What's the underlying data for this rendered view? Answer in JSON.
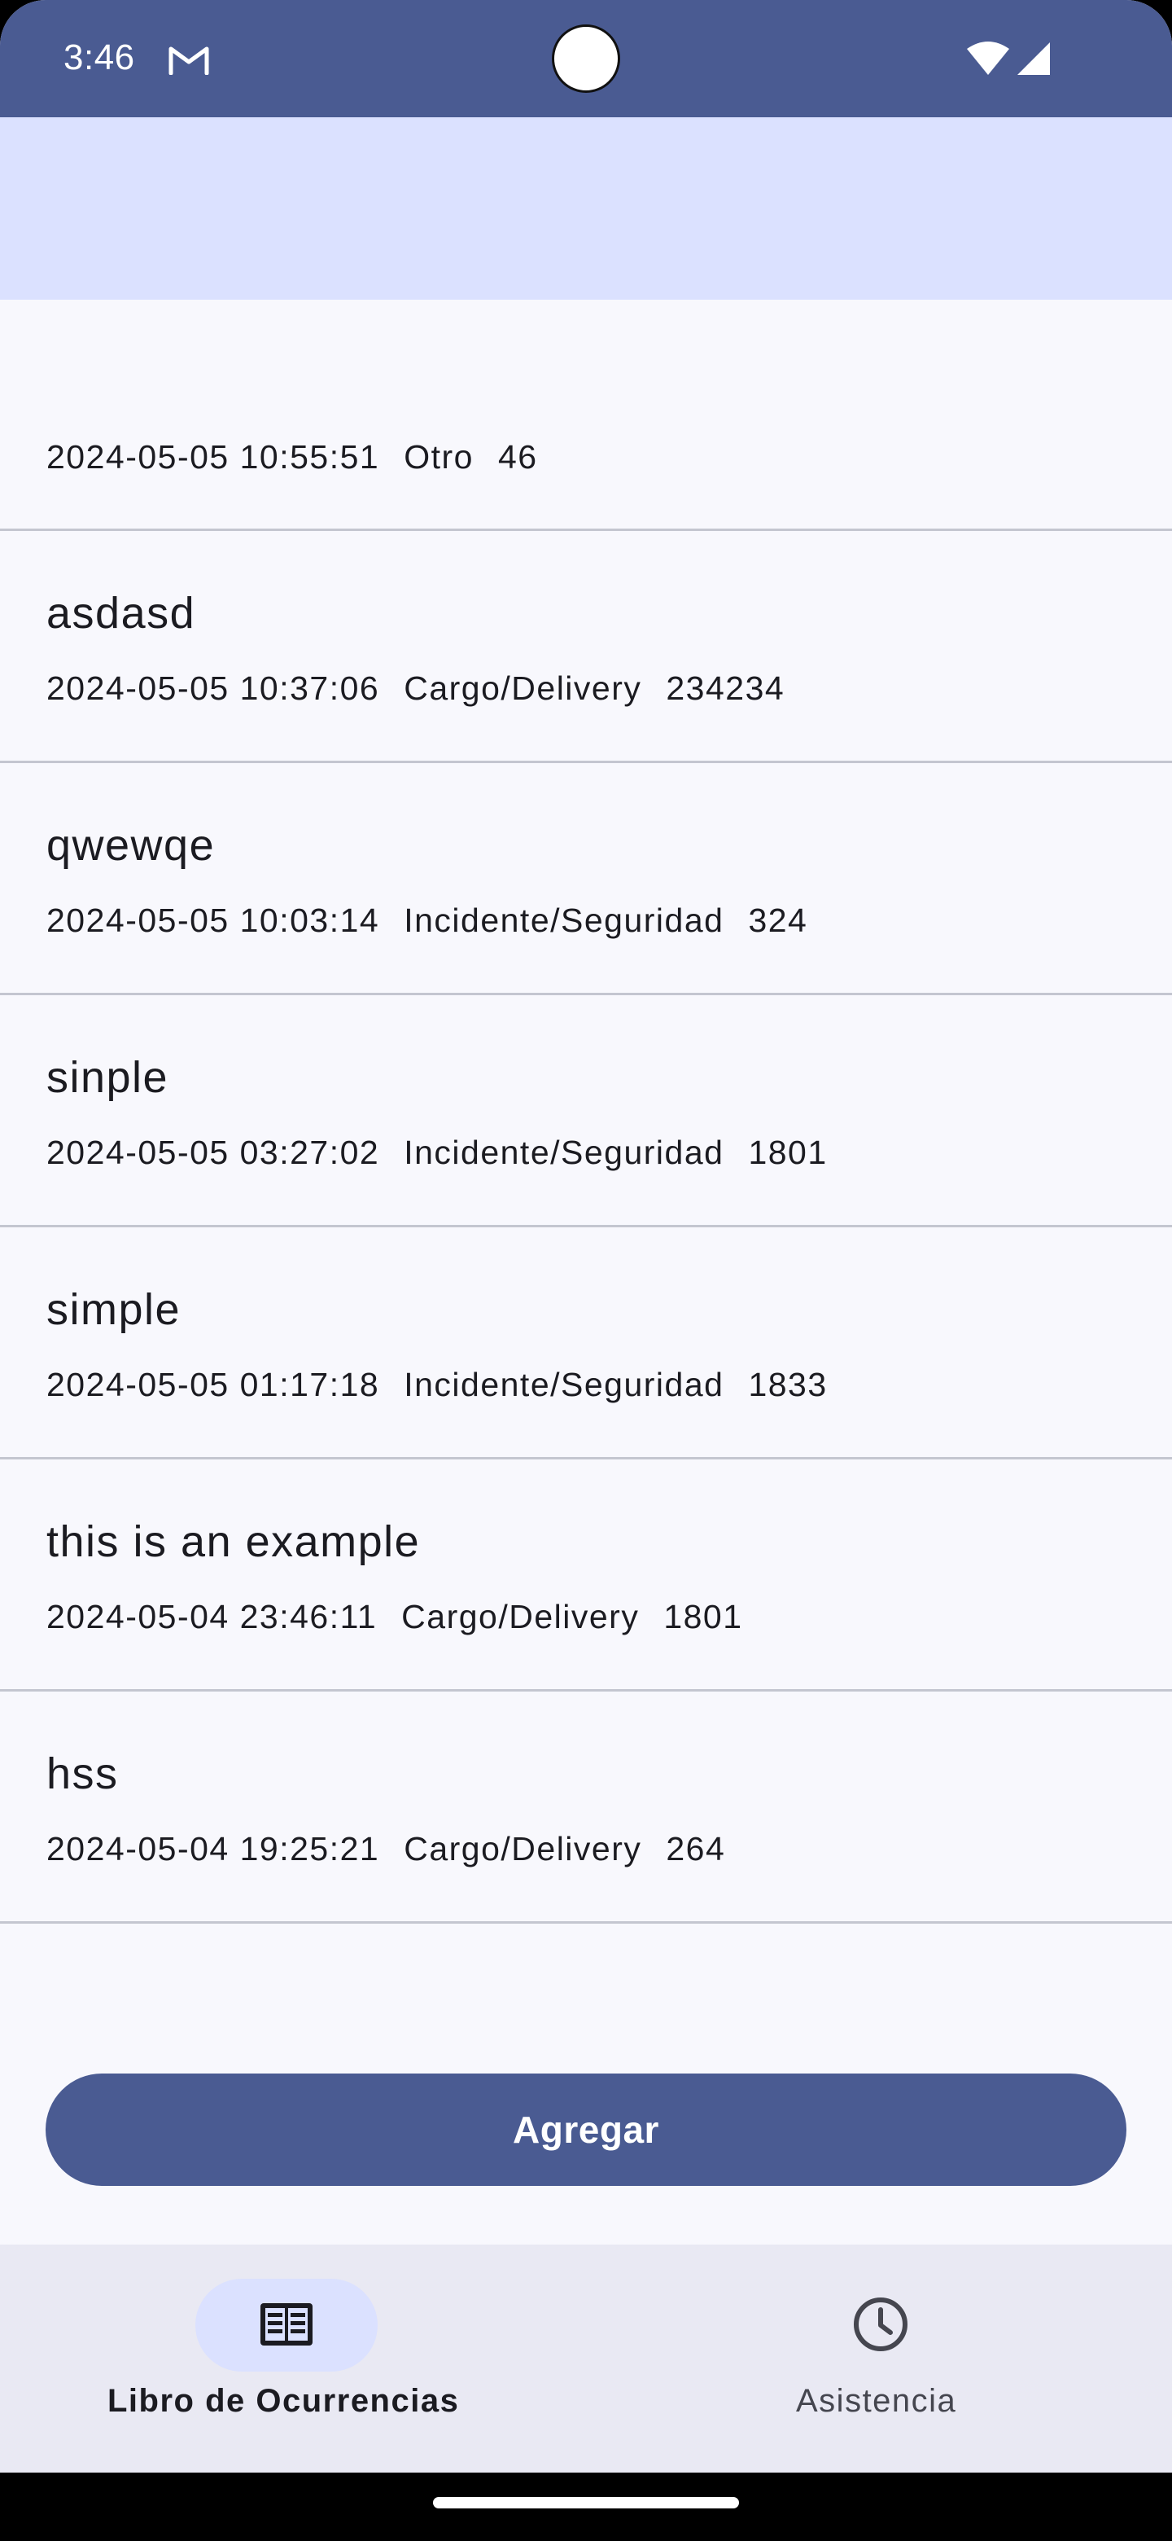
{
  "status_bar": {
    "time": "3:46",
    "icons": [
      "gmail-icon",
      "wifi-icon",
      "signal-icon"
    ]
  },
  "entries": [
    {
      "title": "",
      "datetime": "2024-05-05 10:55:51",
      "category": "Otro",
      "number": "46"
    },
    {
      "title": "asdasd",
      "datetime": "2024-05-05 10:37:06",
      "category": "Cargo/Delivery",
      "number": "234234"
    },
    {
      "title": "qwewqe",
      "datetime": "2024-05-05 10:03:14",
      "category": "Incidente/Seguridad",
      "number": "324"
    },
    {
      "title": "sinple",
      "datetime": "2024-05-05 03:27:02",
      "category": "Incidente/Seguridad",
      "number": "1801"
    },
    {
      "title": "simple",
      "datetime": "2024-05-05 01:17:18",
      "category": "Incidente/Seguridad",
      "number": "1833"
    },
    {
      "title": "this is an example",
      "datetime": "2024-05-04 23:46:11",
      "category": "Cargo/Delivery",
      "number": "1801"
    },
    {
      "title": "hss",
      "datetime": "2024-05-04 19:25:21",
      "category": "Cargo/Delivery",
      "number": "264"
    }
  ],
  "add_button": {
    "label": "Agregar"
  },
  "bottom_nav": {
    "items": [
      {
        "label": "Libro de Ocurrencias",
        "icon": "book-icon",
        "selected": true
      },
      {
        "label": "Asistencia",
        "icon": "clock-icon",
        "selected": false
      }
    ]
  },
  "colors": {
    "primary": "#4a5b92",
    "app_bar": "#dbe1ff",
    "surface": "#f8f8fd",
    "nav_bar": "#e9e9f3",
    "divider": "#c4c6d0"
  }
}
